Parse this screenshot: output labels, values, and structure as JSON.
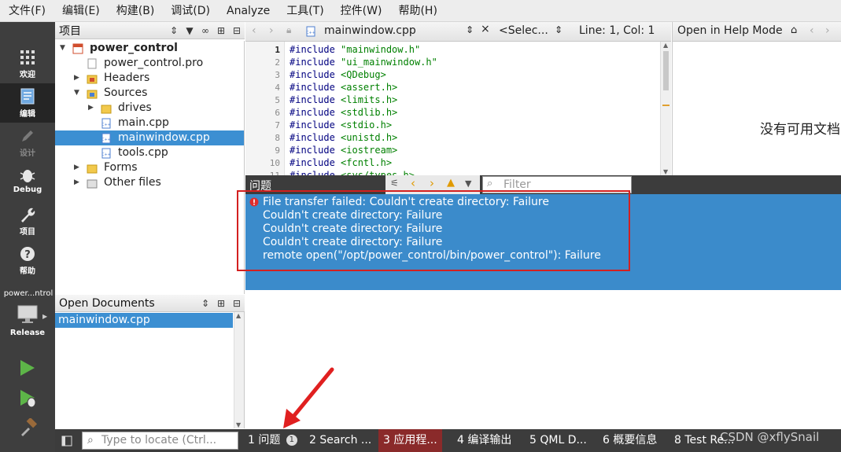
{
  "menu": [
    "文件(F)",
    "编辑(E)",
    "构建(B)",
    "调试(D)",
    "Analyze",
    "工具(T)",
    "控件(W)",
    "帮助(H)"
  ],
  "modes": [
    {
      "label": "欢迎",
      "icon": "grid-icon"
    },
    {
      "label": "编辑",
      "icon": "document-icon"
    },
    {
      "label": "设计",
      "icon": "pencil-icon"
    },
    {
      "label": "Debug",
      "icon": "bug-icon"
    },
    {
      "label": "项目",
      "icon": "wrench-icon"
    },
    {
      "label": "帮助",
      "icon": "help-icon"
    }
  ],
  "target": {
    "project": "power...ntrol",
    "config": "Release"
  },
  "project_pane": {
    "title": "项目",
    "tree": [
      {
        "label": "power_control",
        "bold": true
      },
      {
        "label": "power_control.pro"
      },
      {
        "label": "Headers"
      },
      {
        "label": "Sources"
      },
      {
        "label": "drives"
      },
      {
        "label": "main.cpp"
      },
      {
        "label": "mainwindow.cpp",
        "selected": true
      },
      {
        "label": "tools.cpp"
      },
      {
        "label": "Forms"
      },
      {
        "label": "Other files"
      }
    ]
  },
  "open_docs": {
    "title": "Open Documents",
    "items": [
      "mainwindow.cpp"
    ]
  },
  "editor": {
    "file": "mainwindow.cpp",
    "symbol": "<Selec...",
    "position": "Line: 1, Col: 1",
    "lines": [
      {
        "n": "1",
        "text": "\"mainwindow.h\""
      },
      {
        "n": "2",
        "text": "\"ui_mainwindow.h\""
      },
      {
        "n": "3",
        "text": "<QDebug>"
      },
      {
        "n": "4",
        "text": "<assert.h>"
      },
      {
        "n": "5",
        "text": "<limits.h>"
      },
      {
        "n": "6",
        "text": "<stdlib.h>"
      },
      {
        "n": "7",
        "text": "<stdio.h>"
      },
      {
        "n": "8",
        "text": "<unistd.h>"
      },
      {
        "n": "9",
        "text": "<iostream>"
      },
      {
        "n": "10",
        "text": "<fcntl.h>"
      },
      {
        "n": "11",
        "text": "<sys/types.h>"
      }
    ],
    "directive": "#include"
  },
  "help": {
    "mode": "Open in Help Mode",
    "empty_text": "没有可用文档"
  },
  "issues": {
    "title": "问题",
    "filter_placeholder": "Filter",
    "messages": [
      "File transfer failed: Couldn't create directory: Failure",
      "Couldn't create directory: Failure",
      "Couldn't create directory: Failure",
      "Couldn't create directory: Failure",
      "remote open(\"/opt/power_control/bin/power_control\"): Failure"
    ]
  },
  "output_tabs": [
    {
      "label": "1  问题",
      "badge": "1"
    },
    {
      "label": "2  Search ..."
    },
    {
      "label": "3  应用程..."
    },
    {
      "label": "4  编译输出"
    },
    {
      "label": "5  QML D..."
    },
    {
      "label": "6  概要信息"
    },
    {
      "label": "8  Test Re..."
    }
  ],
  "locate_placeholder": "Type to locate (Ctrl...",
  "watermark": "CSDN @xflySnail",
  "colors": {
    "selection": "#3c8fd2",
    "issues_bg": "#3b8bcb",
    "annotation": "#d32020",
    "sidebar": "#3e3e3e"
  }
}
